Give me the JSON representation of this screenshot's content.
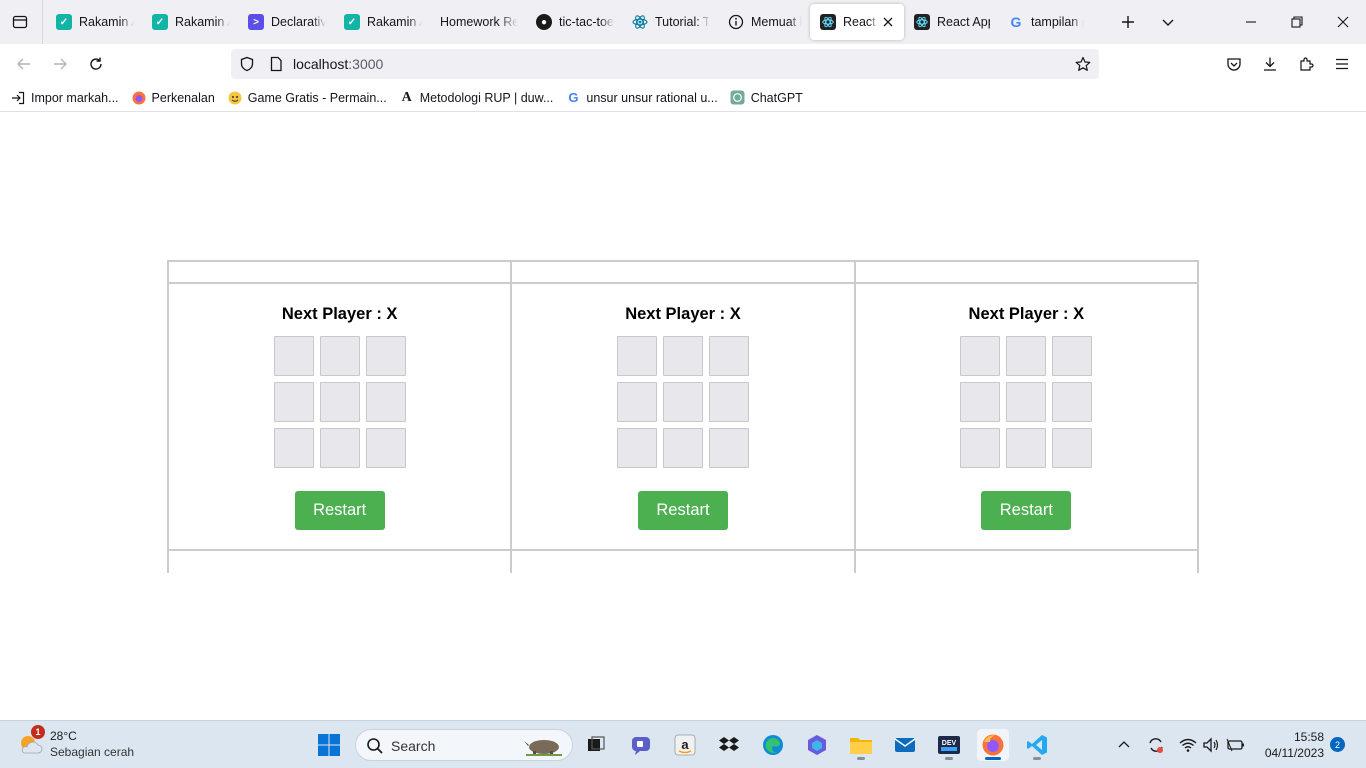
{
  "browser": {
    "tabs": [
      {
        "label": "Rakamin Academy",
        "icon": "rakamin-icon",
        "color": "#12b5a5"
      },
      {
        "label": "Rakamin Academy",
        "icon": "rakamin-icon",
        "color": "#12b5a5"
      },
      {
        "label": "Declarative",
        "icon": "terminal-icon",
        "color": "#5b4fe8"
      },
      {
        "label": "Rakamin Academy",
        "icon": "rakamin-icon",
        "color": "#12b5a5"
      },
      {
        "label": "Homework Re",
        "icon": "none"
      },
      {
        "label": "tic-tac-toe",
        "icon": "github-icon",
        "color": "#1a1a1a"
      },
      {
        "label": "Tutorial: Tic",
        "icon": "react-icon",
        "color": "#087ea4"
      },
      {
        "label": "Memuat l",
        "icon": "info-icon",
        "color": "#1a1a1a"
      },
      {
        "label": "React App",
        "icon": "react-app-icon",
        "color": "#222"
      },
      {
        "label": "React App",
        "icon": "react-app-icon",
        "color": "#222"
      },
      {
        "label": "tampilan g",
        "icon": "google-icon"
      }
    ],
    "active_tab_index": 8,
    "url_host": "localhost",
    "url_port": ":3000",
    "bookmarks": [
      {
        "label": "Impor markah...",
        "icon": "import-icon"
      },
      {
        "label": "Perkenalan",
        "icon": "firefox-icon"
      },
      {
        "label": "Game Gratis - Permain...",
        "icon": "game-icon"
      },
      {
        "label": "Metodologi RUP | duw...",
        "icon": "medium-icon"
      },
      {
        "label": "unsur unsur rational u...",
        "icon": "google-icon"
      },
      {
        "label": "ChatGPT",
        "icon": "chatgpt-icon"
      }
    ]
  },
  "app": {
    "games": [
      {
        "status": "Next Player : X",
        "restart_label": "Restart",
        "squares": [
          "",
          "",
          "",
          "",
          "",
          "",
          "",
          "",
          ""
        ]
      },
      {
        "status": "Next Player : X",
        "restart_label": "Restart",
        "squares": [
          "",
          "",
          "",
          "",
          "",
          "",
          "",
          "",
          ""
        ]
      },
      {
        "status": "Next Player : X",
        "restart_label": "Restart",
        "squares": [
          "",
          "",
          "",
          "",
          "",
          "",
          "",
          "",
          ""
        ]
      }
    ],
    "colors": {
      "restart_bg": "#4caf50",
      "square_bg": "#e8e8ec",
      "border": "#cccccc"
    }
  },
  "taskbar": {
    "weather_temp": "28°C",
    "weather_desc": "Sebagian cerah",
    "weather_badge": "1",
    "search_label": "Search",
    "time": "15:58",
    "date": "04/11/2023",
    "notification_count": "2"
  }
}
